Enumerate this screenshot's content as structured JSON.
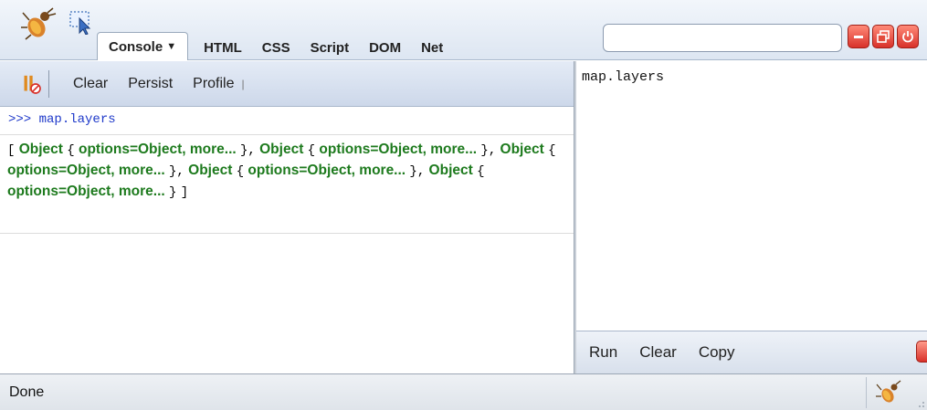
{
  "toolbar": {
    "tabs": [
      {
        "label": "Console",
        "active": true,
        "caret": "▼"
      },
      {
        "label": "HTML"
      },
      {
        "label": "CSS"
      },
      {
        "label": "Script"
      },
      {
        "label": "DOM"
      },
      {
        "label": "Net"
      }
    ],
    "search": {
      "value": "",
      "placeholder": ""
    },
    "window_buttons": [
      "minimize-icon",
      "detach-icon",
      "power-icon"
    ]
  },
  "console_toolbar": {
    "clear_label": "Clear",
    "persist_label": "Persist",
    "profile_label": "Profile",
    "separator": "|"
  },
  "console": {
    "prompt": ">>>",
    "command": "map.layers",
    "result": {
      "open": "[",
      "close": "]",
      "items": [
        {
          "name": "Object",
          "prop": "options=Object,",
          "more": "more..."
        },
        {
          "name": "Object",
          "prop": "options=Object,",
          "more": "more..."
        },
        {
          "name": "Object",
          "prop": "options=Object,",
          "more": "more..."
        },
        {
          "name": "Object",
          "prop": "options=Object,",
          "more": "more..."
        },
        {
          "name": "Object",
          "prop": "options=Object,",
          "more": "more..."
        }
      ]
    }
  },
  "editor": {
    "value": "map.layers",
    "run_label": "Run",
    "clear_label": "Clear",
    "copy_label": "Copy"
  },
  "status": {
    "text": "Done"
  },
  "colors": {
    "command_blue": "#1d38c9",
    "object_green": "#1d7a1d",
    "button_red": "#d8312a"
  }
}
